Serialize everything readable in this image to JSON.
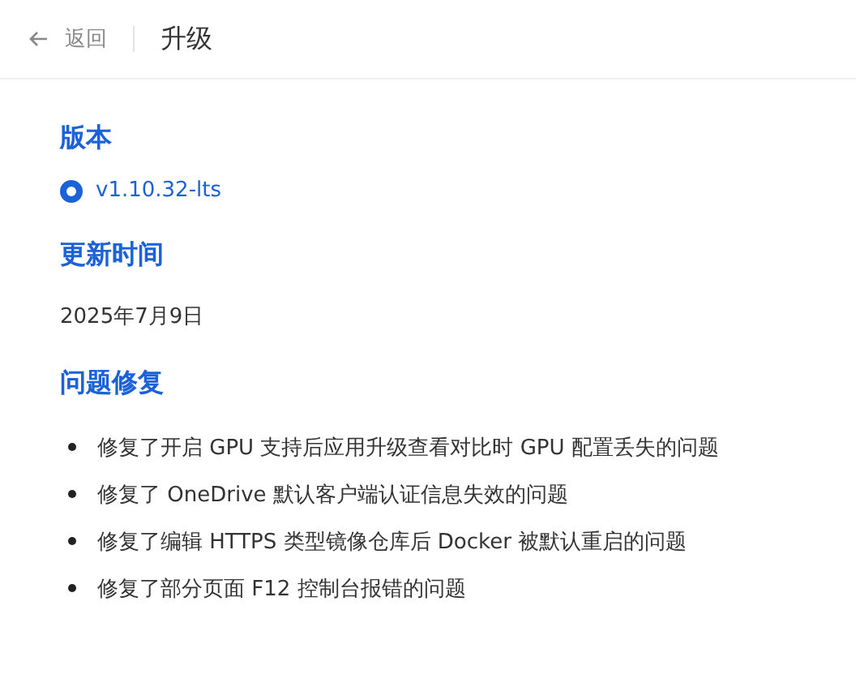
{
  "header": {
    "back_label": "返回",
    "title": "升级"
  },
  "sections": [
    {
      "kind": "radio",
      "heading": "版本",
      "options": [
        {
          "label": "v1.10.32-lts",
          "selected": true
        }
      ]
    },
    {
      "kind": "text",
      "heading": "更新时间",
      "text": "2025年7月9日"
    },
    {
      "kind": "list",
      "heading": "问题修复",
      "items": [
        "修复了开启 GPU 支持后应用升级查看对比时 GPU 配置丢失的问题",
        "修复了 OneDrive 默认客户端认证信息失效的问题",
        "修复了编辑 HTTPS 类型镜像仓库后 Docker 被默认重启的问题",
        "修复了部分页面 F12 控制台报错的问题"
      ]
    }
  ]
}
